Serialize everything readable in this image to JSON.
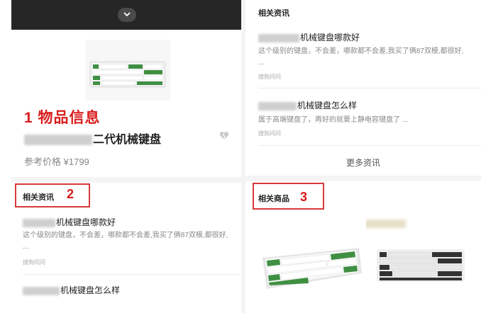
{
  "annotations": {
    "one": "1",
    "two": "2",
    "three": "3"
  },
  "product": {
    "section_title": "物品信息",
    "title_visible": "二代机械键盘",
    "price_label": "参考价格",
    "price": "¥1799",
    "heart_icon": "heart-broken-icon"
  },
  "topbar": {
    "chevron_icon": "chevron-down-icon"
  },
  "left_news": {
    "label": "相关资讯",
    "items": [
      {
        "title": "机械键盘哪款好",
        "summary": "这个级别的键盘，不会差，哪款都不会差,我买了俩87双模,都很好, ...",
        "source": "搜狗问问"
      },
      {
        "title": "机械键盘怎么样"
      }
    ]
  },
  "right_news": {
    "label": "相关资讯",
    "items": [
      {
        "title": "机械键盘哪款好",
        "summary": "这个级别的键盘，不会差，哪款都不会差,我买了俩87双模,都很好, ...",
        "source": "搜狗问问"
      },
      {
        "title": "机械键盘怎么样",
        "summary": "属于高端键盘了，再好的就要上静电容键盘了 ...",
        "source": "搜狗问问"
      }
    ],
    "more": "更多资讯"
  },
  "related_products": {
    "label": "相关商品"
  },
  "colors": {
    "annotation_red": "#d91c1c",
    "keyboard_green": "#3f8f43",
    "topbar": "#262626"
  }
}
